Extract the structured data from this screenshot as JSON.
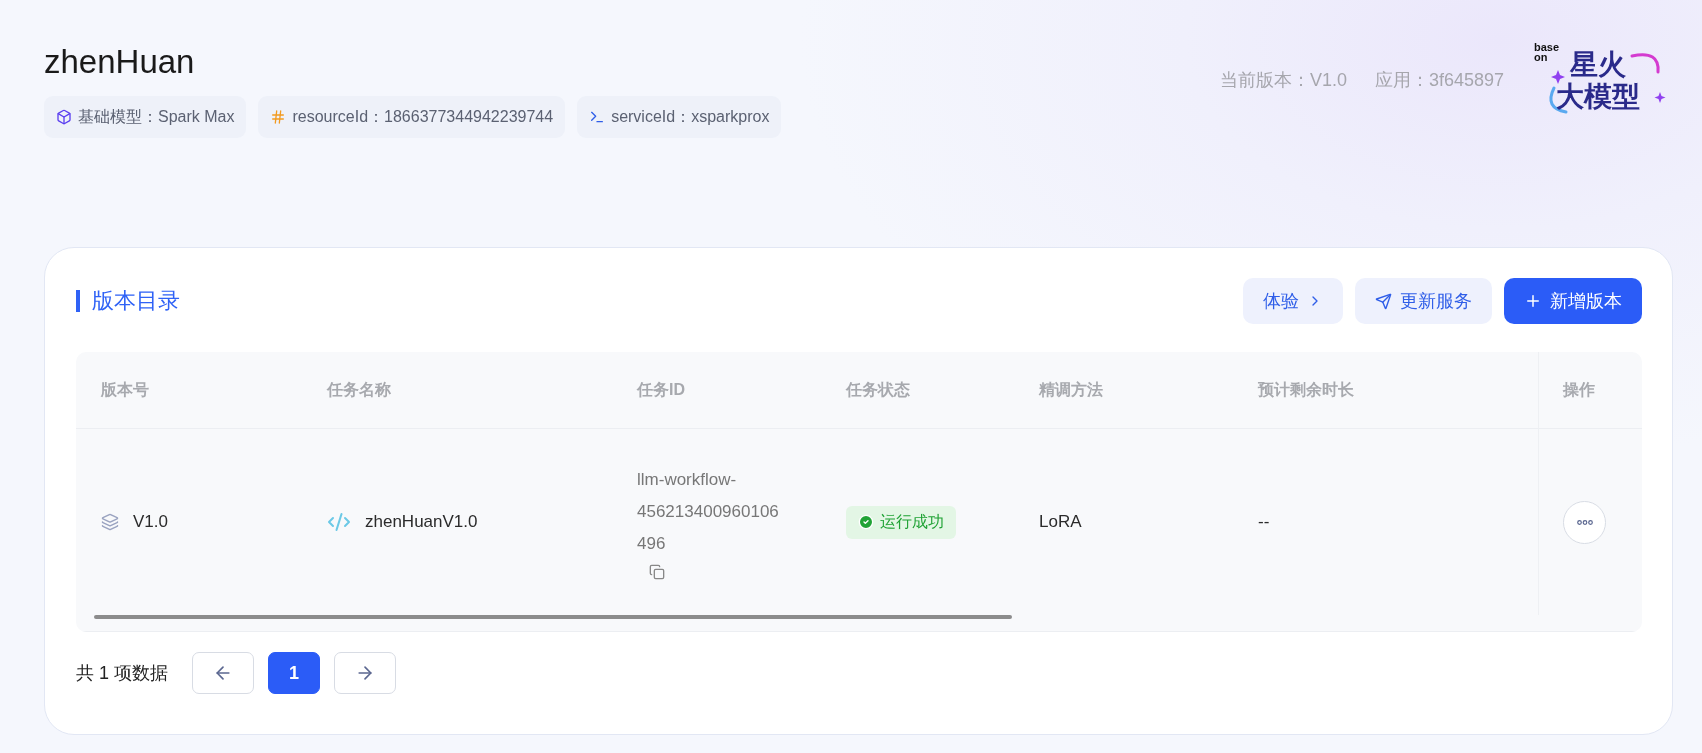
{
  "header": {
    "title": "zhenHuan",
    "chips": [
      {
        "kind": "model",
        "label": "基础模型：Spark Max"
      },
      {
        "kind": "resource",
        "label": "resourceId：1866377344942239744"
      },
      {
        "kind": "service",
        "label": "serviceId：xsparkprox"
      }
    ],
    "meta": [
      "当前版本：V1.0",
      "应用：3f645897"
    ],
    "logo": {
      "prefix": [
        "base",
        "on"
      ],
      "line_1": "星火",
      "line_2": "大模型"
    }
  },
  "section": {
    "title": "版本目录",
    "actions": [
      {
        "kind": "try",
        "label": "体验"
      },
      {
        "kind": "update",
        "label": "更新服务"
      },
      {
        "kind": "add",
        "label": "新增版本"
      }
    ]
  },
  "table": {
    "columns": [
      "版本号",
      "任务名称",
      "任务ID",
      "任务状态",
      "精调方法",
      "预计剩余时长",
      "操作"
    ],
    "rows": [
      {
        "version": "V1.0",
        "task_name": "zhenHuanV1.0",
        "task_id": "llm-workflow-456213400960106496",
        "status": {
          "label": "运行成功",
          "kind": "success"
        },
        "method": "LoRA",
        "remaining": "--"
      }
    ]
  },
  "pagination": {
    "total": "共 1 项数据",
    "pages": [
      {
        "label": "1",
        "selected": true
      }
    ]
  }
}
